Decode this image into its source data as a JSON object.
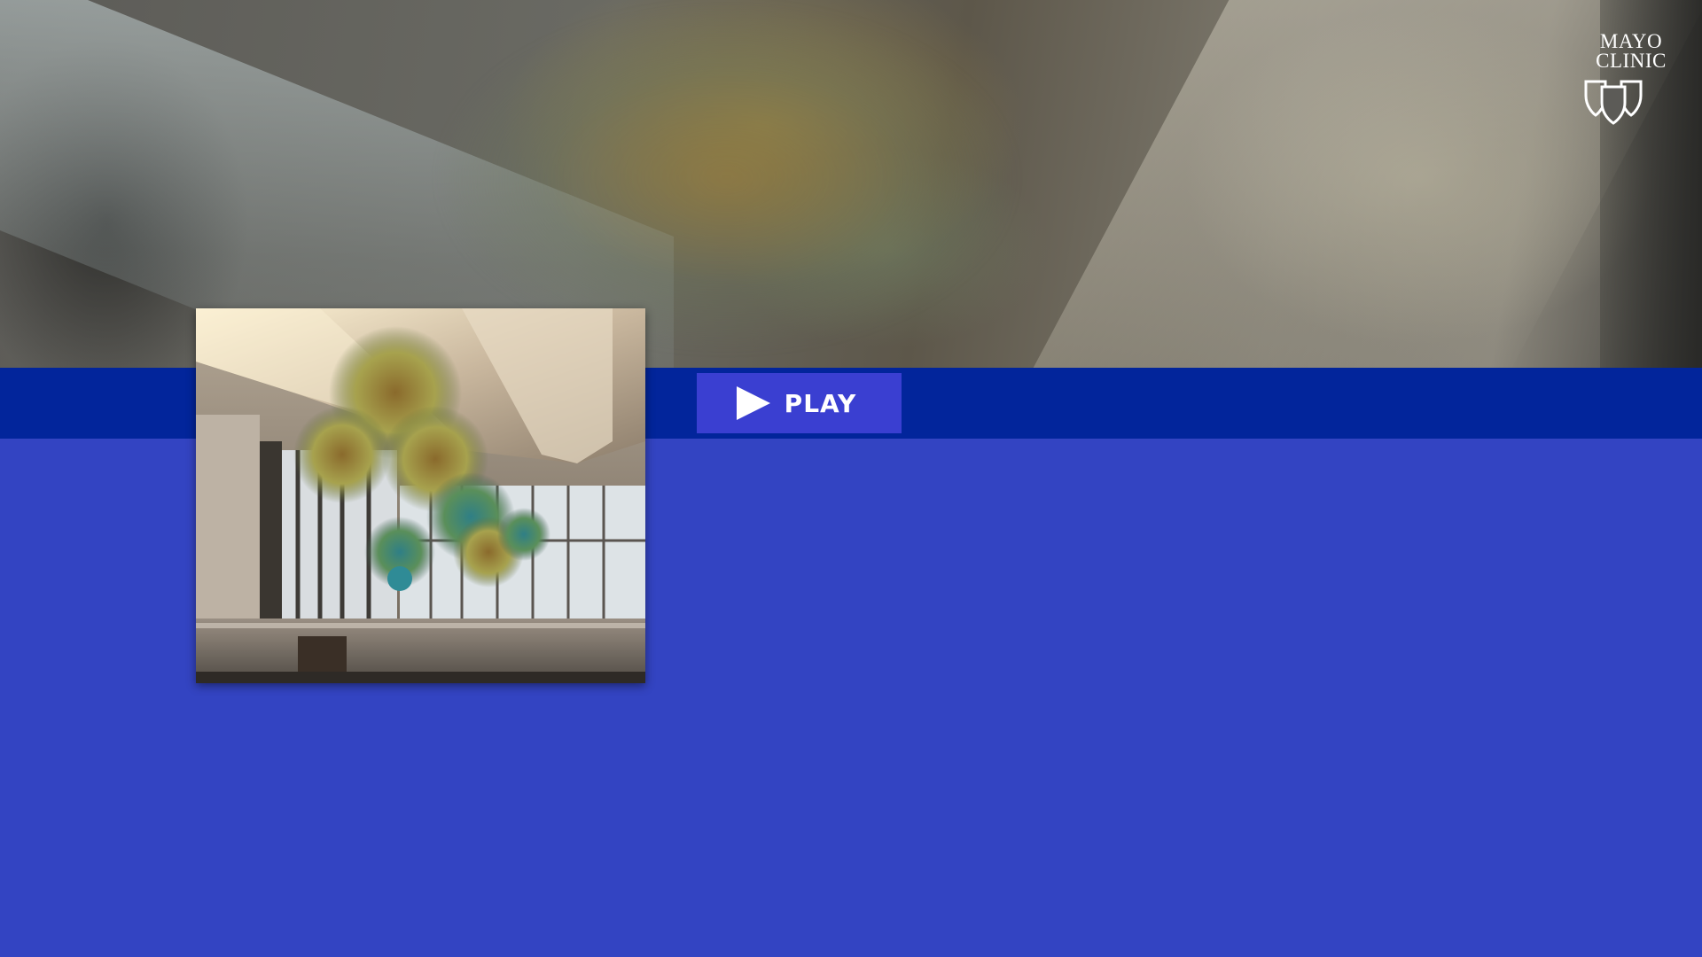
{
  "brand": {
    "logo_line1": "MAYO",
    "logo_line2": "CLINIC",
    "logo_icon": "three-shields-icon"
  },
  "player": {
    "play_label": "PLAY",
    "play_icon": "play-icon",
    "thumbnail_icon": "video-thumbnail"
  },
  "colors": {
    "page_background": "#3344c2",
    "band": "#02259b",
    "play_button": "#3a3fd1",
    "text": "#ffffff"
  }
}
